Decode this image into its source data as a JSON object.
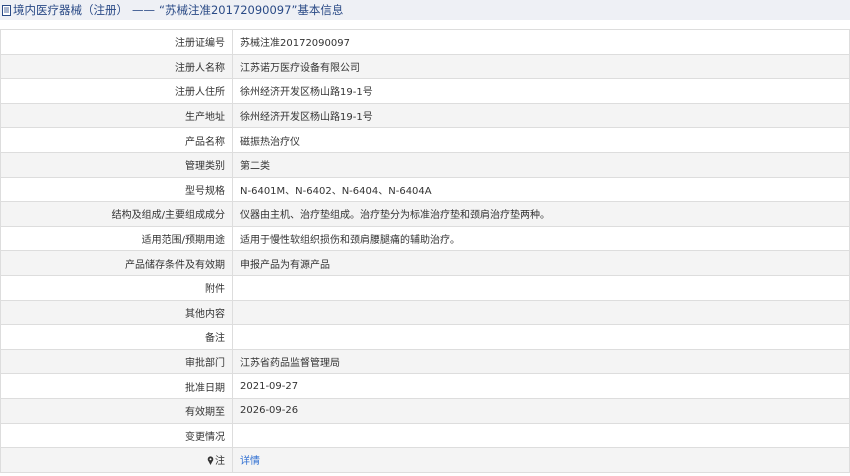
{
  "header": {
    "section": "境内医疗器械（注册）",
    "separator": "——",
    "subject": "“苏械注准20172090097”基本信息"
  },
  "rows": [
    {
      "label": "注册证编号",
      "value": "苏械注准20172090097"
    },
    {
      "label": "注册人名称",
      "value": "江苏诺万医疗设备有限公司"
    },
    {
      "label": "注册人住所",
      "value": "徐州经济开发区杨山路19-1号"
    },
    {
      "label": "生产地址",
      "value": "徐州经济开发区杨山路19-1号"
    },
    {
      "label": "产品名称",
      "value": "磁振热治疗仪"
    },
    {
      "label": "管理类别",
      "value": "第二类"
    },
    {
      "label": "型号规格",
      "value": "N-6401M、N-6402、N-6404、N-6404A"
    },
    {
      "label": "结构及组成/主要组成成分",
      "value": "仪器由主机、治疗垫组成。治疗垫分为标准治疗垫和颈肩治疗垫两种。"
    },
    {
      "label": "适用范围/预期用途",
      "value": "适用于慢性软组织损伤和颈肩腰腿痛的辅助治疗。"
    },
    {
      "label": "产品储存条件及有效期",
      "value": "申报产品为有源产品"
    },
    {
      "label": "附件",
      "value": ""
    },
    {
      "label": "其他内容",
      "value": ""
    },
    {
      "label": "备注",
      "value": ""
    },
    {
      "label": "审批部门",
      "value": "江苏省药品监督管理局"
    },
    {
      "label": "批准日期",
      "value": "2021-09-27"
    },
    {
      "label": "有效期至",
      "value": "2026-09-26"
    },
    {
      "label": "变更情况",
      "value": ""
    },
    {
      "label": "注",
      "value": "详情",
      "icon": "pin-icon",
      "link": true
    }
  ],
  "colors": {
    "header_bg": "#eef0f5",
    "header_text": "#2a4a86",
    "link": "#2f6fd2",
    "row_alt": "#f4f4f4",
    "border": "#dddddd"
  }
}
